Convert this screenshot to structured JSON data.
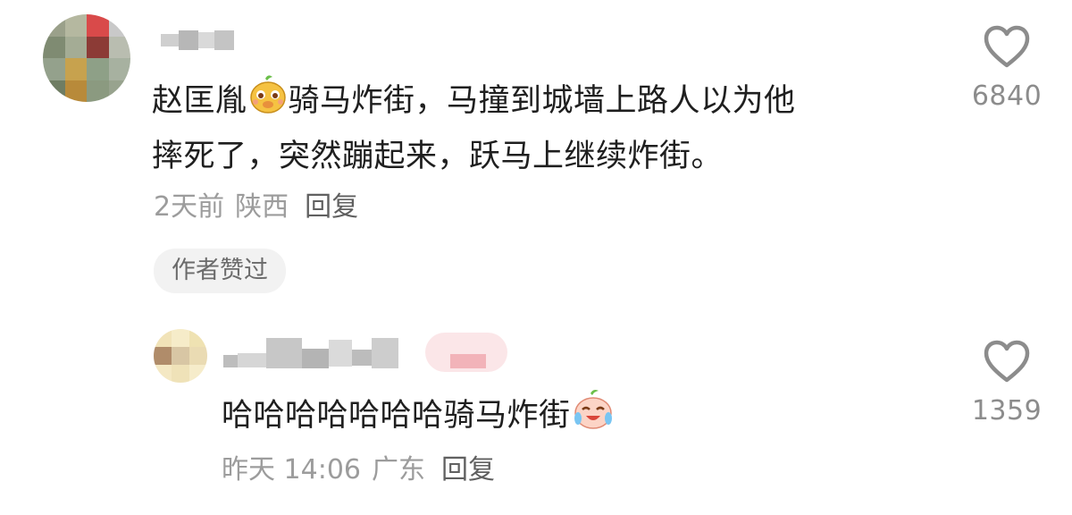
{
  "comment": {
    "line1_a": "赵匡胤",
    "line1_b": "骑马炸街，马撞到城墙上路人以为他",
    "line2": "摔死了，突然蹦起来，跃马上继续炸街。",
    "emoji_name": "laughing-face-emoji",
    "time": "2天前",
    "location": "陕西",
    "reply_label": "回复",
    "author_liked_label": "作者赞过",
    "like_count": "6840"
  },
  "reply": {
    "text": "哈哈哈哈哈哈哈骑马炸街",
    "emoji_name": "crying-laughing-emoji",
    "time": "昨天 14:06",
    "location": "广东",
    "reply_label": "回复",
    "like_count": "1359"
  },
  "colors": {
    "text": "#1f1f1f",
    "meta": "#9c9c9c",
    "pill_bg": "#f2f2f2",
    "heart": "#8c8c8c"
  }
}
